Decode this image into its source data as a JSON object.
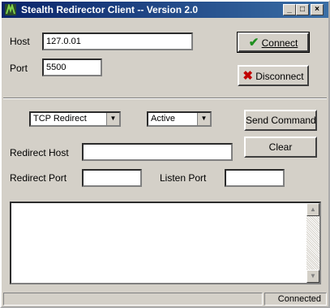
{
  "window": {
    "title": "Stealth Redirector Client -- Version 2.0",
    "icons": [
      "app-icon",
      "minimize-icon",
      "maximize-icon",
      "close-icon"
    ]
  },
  "connection": {
    "host_label": "Host",
    "host_value": "127.0.01",
    "port_label": "Port",
    "port_value": "5500",
    "connect_label": "Connect",
    "disconnect_label": "Disconnect"
  },
  "command": {
    "mode_value": "TCP Redirect",
    "state_value": "Active",
    "send_label": "Send Command",
    "clear_label": "Clear",
    "redirect_host_label": "Redirect Host",
    "redirect_host_value": "",
    "redirect_port_label": "Redirect Port",
    "redirect_port_value": "",
    "listen_port_label": "Listen Port",
    "listen_port_value": ""
  },
  "log": {
    "text": ""
  },
  "statusbar": {
    "left": "",
    "right": "Connected"
  },
  "colors": {
    "titlebar": "#0a246a",
    "face": "#d4d0c8",
    "check": "#1f8f1f",
    "cross": "#c00000"
  }
}
